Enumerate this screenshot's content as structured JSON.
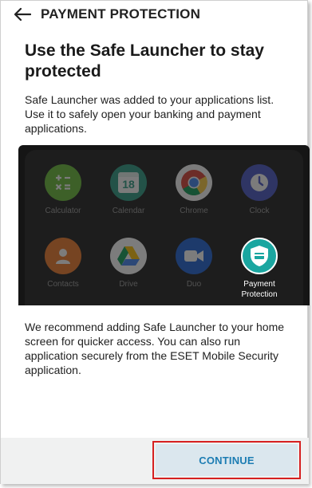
{
  "header": {
    "title": "PAYMENT PROTECTION"
  },
  "content": {
    "heading": "Use the Safe Launcher to stay protected",
    "paragraph1": "Safe Launcher was added to your applications list. Use it to safely open your banking and payment applications.",
    "paragraph2": "We recommend adding Safe Launcher to your home screen for quicker access. You can also run application securely from the ESET Mobile Security application."
  },
  "apps": [
    {
      "label": "Calculator",
      "icon": "calculator-icon"
    },
    {
      "label": "Calendar",
      "icon": "calendar-icon",
      "date": "18"
    },
    {
      "label": "Chrome",
      "icon": "chrome-icon"
    },
    {
      "label": "Clock",
      "icon": "clock-icon"
    },
    {
      "label": "Contacts",
      "icon": "contacts-icon"
    },
    {
      "label": "Drive",
      "icon": "drive-icon"
    },
    {
      "label": "Duo",
      "icon": "duo-icon"
    },
    {
      "label": "Payment Protection",
      "icon": "payment-protection-icon"
    }
  ],
  "footer": {
    "continue_label": "CONTINUE"
  },
  "colors": {
    "accent": "#1d7db3",
    "button_bg": "#dbe7ee",
    "highlight": "#d62020",
    "payment_teal": "#1aa6a0"
  }
}
